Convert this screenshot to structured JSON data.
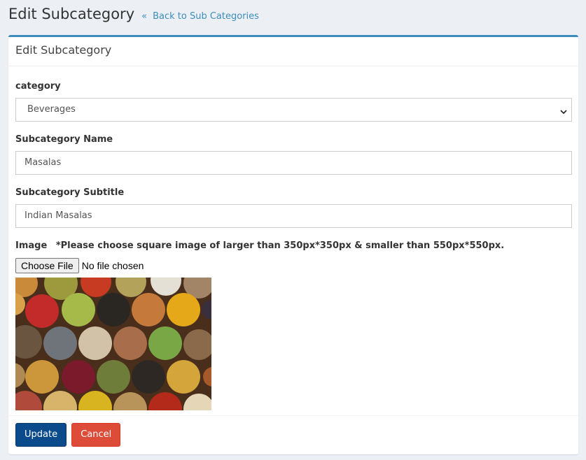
{
  "header": {
    "title": "Edit Subcategory",
    "back_icon": "«",
    "back_label": "Back to Sub Categories"
  },
  "box": {
    "title": "Edit Subcategory"
  },
  "form": {
    "category": {
      "label": "category",
      "value": "Beverages"
    },
    "name": {
      "label": "Subcategory Name",
      "value": "Masalas"
    },
    "subtitle": {
      "label": "Subcategory Subtitle",
      "value": "Indian Masalas"
    },
    "image": {
      "label": "Image",
      "note": "*Please choose square image of larger than 350px*350px & smaller than 550px*550px.",
      "button_label": "Choose File",
      "file_status": "No file chosen",
      "preview_icon": "spice-bowls-photo"
    }
  },
  "footer": {
    "update_label": "Update",
    "cancel_label": "Cancel"
  },
  "colors": {
    "accent": "#3c8dbc",
    "primary_button": "#0b4a8b",
    "danger_button": "#dd4b39",
    "background": "#ecf0f5"
  }
}
